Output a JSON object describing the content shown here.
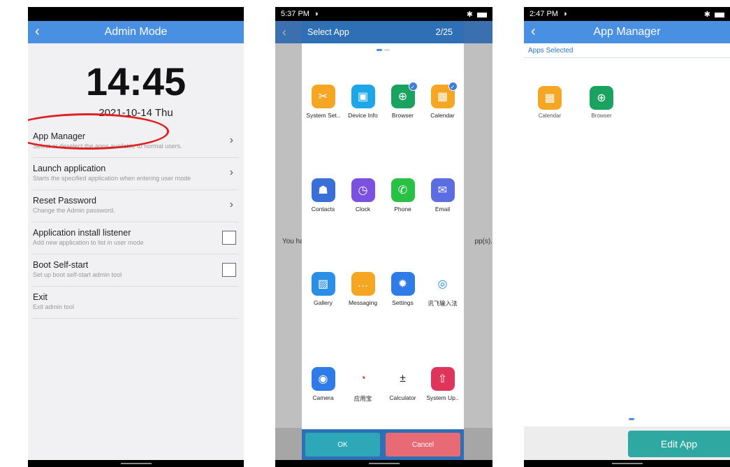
{
  "panel1": {
    "title": "Admin Mode",
    "clock": "14:45",
    "date": "2021-10-14 Thu",
    "items": [
      {
        "title": "App Manager",
        "subtitle": "Select or deselect the apps available to normal users."
      },
      {
        "title": "Launch application",
        "subtitle": "Starts the specified application when entering user mode"
      },
      {
        "title": "Reset Password",
        "subtitle": "Change the Admin password."
      },
      {
        "title": "Application install listener",
        "subtitle": "Add new application to list in user mode"
      },
      {
        "title": "Boot Self-start",
        "subtitle": "Set up boot self-start admin tool"
      },
      {
        "title": "Exit",
        "subtitle": "Exit admin tool"
      }
    ]
  },
  "panel2": {
    "time": "5:37 PM",
    "dialog_title": "Select App",
    "page_count": "2/25",
    "bg_text_left": "You ha",
    "bg_text_right": "pp(s).",
    "apps": [
      {
        "label": "System Set..",
        "icon": "tools-icon",
        "color": "#f5a623",
        "selected": false
      },
      {
        "label": "Device Info",
        "icon": "chip-icon",
        "color": "#1ea7e8",
        "selected": false
      },
      {
        "label": "Browser",
        "icon": "globe-icon",
        "color": "#1aa260",
        "selected": true
      },
      {
        "label": "Calendar",
        "icon": "calendar-icon",
        "color": "#f5a623",
        "selected": true
      },
      {
        "label": "Contacts",
        "icon": "contacts-icon",
        "color": "#3b6fd8",
        "selected": false
      },
      {
        "label": "Clock",
        "icon": "clock-icon",
        "color": "#7b52e0",
        "selected": false
      },
      {
        "label": "Phone",
        "icon": "phone-icon",
        "color": "#28c145",
        "selected": false
      },
      {
        "label": "Email",
        "icon": "mail-icon",
        "color": "#5b6de0",
        "selected": false
      },
      {
        "label": "Gallery",
        "icon": "gallery-icon",
        "color": "#2b8fe8",
        "selected": false
      },
      {
        "label": "Messaging",
        "icon": "message-icon",
        "color": "#f5a623",
        "selected": false
      },
      {
        "label": "Settings",
        "icon": "gear-icon",
        "color": "#2f7be8",
        "selected": false
      },
      {
        "label": "讯飞输入法",
        "icon": "ifly-icon",
        "color": "#ffffff",
        "selected": false
      },
      {
        "label": "Camera",
        "icon": "camera-icon",
        "color": "#2f7be8",
        "selected": false
      },
      {
        "label": "应用宝",
        "icon": "appstore-icon",
        "color": "#ffffff",
        "selected": false
      },
      {
        "label": "Calculator",
        "icon": "calculator-icon",
        "color": "#ffffff",
        "selected": false
      },
      {
        "label": "System Up..",
        "icon": "upload-icon",
        "color": "#e0355a",
        "selected": false
      }
    ],
    "ok": "OK",
    "cancel": "Cancel"
  },
  "panel3": {
    "time": "2:47 PM",
    "title": "App Manager",
    "section": "Apps Selected",
    "apps": [
      {
        "label": "Calendar",
        "icon": "calendar-icon",
        "color": "#f5a623"
      },
      {
        "label": "Browser",
        "icon": "globe-icon",
        "color": "#1aa260"
      }
    ],
    "edit": "Edit App"
  }
}
